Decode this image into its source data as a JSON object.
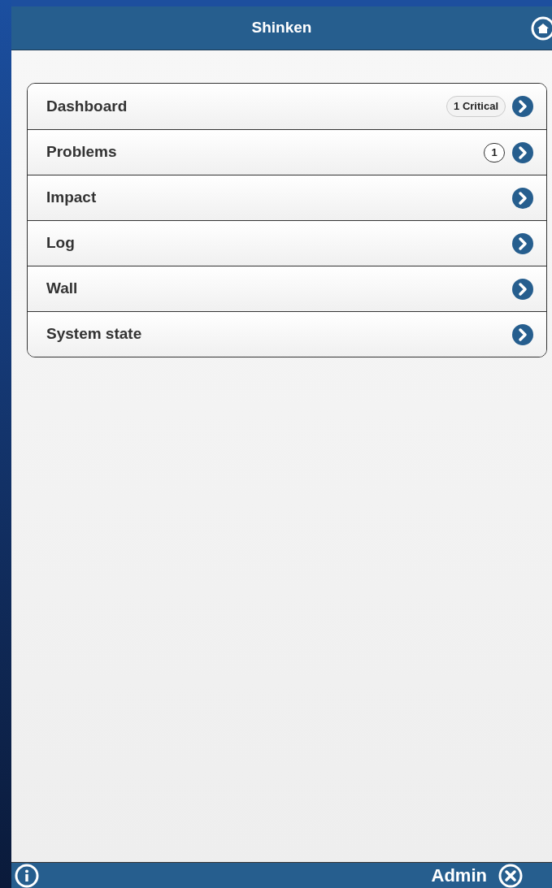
{
  "header": {
    "title": "Shinken"
  },
  "menu": [
    {
      "label": "Dashboard",
      "badge": "1 Critical",
      "kind": "pill"
    },
    {
      "label": "Problems",
      "badge": "1",
      "kind": "count"
    },
    {
      "label": "Impact"
    },
    {
      "label": "Log"
    },
    {
      "label": "Wall"
    },
    {
      "label": "System state"
    }
  ],
  "footer": {
    "user": "Admin"
  }
}
